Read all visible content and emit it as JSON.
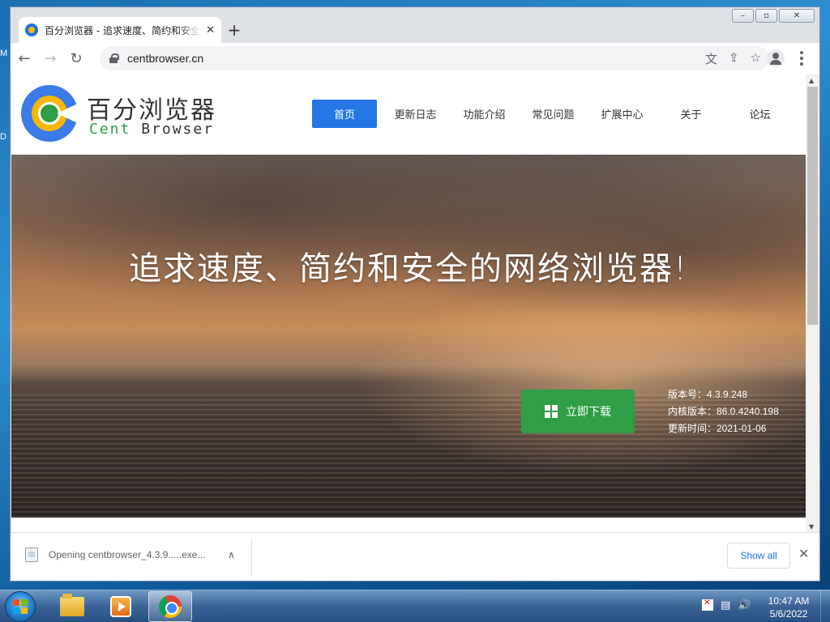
{
  "desktop": {
    "left_labels": [
      "M",
      "D"
    ]
  },
  "window": {
    "controls": {
      "minimize": "–",
      "maximize": "▫",
      "close": "✕"
    }
  },
  "tab": {
    "title": "百分浏览器 - 追求速度、简约和安全的网络浏览器！",
    "close": "✕",
    "new_tab": "+"
  },
  "toolbar": {
    "back": "←",
    "forward": "→",
    "reload": "↻",
    "url": "centbrowser.cn",
    "translate_icon": "文",
    "share_icon": "⇪",
    "star_icon": "☆"
  },
  "site": {
    "brand_cn": "百分浏览器",
    "brand_en_1": "Cent",
    "brand_en_2": "Browser",
    "nav": [
      "首页",
      "更新日志",
      "功能介绍",
      "常见问题",
      "扩展中心",
      "关于",
      "论坛"
    ],
    "active_nav_index": 0,
    "headline": "追求速度、简约和安全的网络浏览器!",
    "download_label": "立即下载",
    "version_lines": [
      "版本号：4.3.9.248",
      "内核版本：86.0.4240.198",
      "更新时间：2021-01-06"
    ],
    "colors": {
      "primary": "#2577e3",
      "download": "#2f9e44"
    }
  },
  "download_shelf": {
    "item_text": "Opening centbrowser_4.3.9.....exe...",
    "chevron": "∧",
    "show_all": "Show all",
    "close": "✕"
  },
  "taskbar": {
    "time": "10:47 AM",
    "date": "5/6/2022",
    "tray_icons": [
      "action-center-flag-icon",
      "network-icon",
      "volume-icon"
    ],
    "volume": "🔊",
    "network": "▤"
  }
}
